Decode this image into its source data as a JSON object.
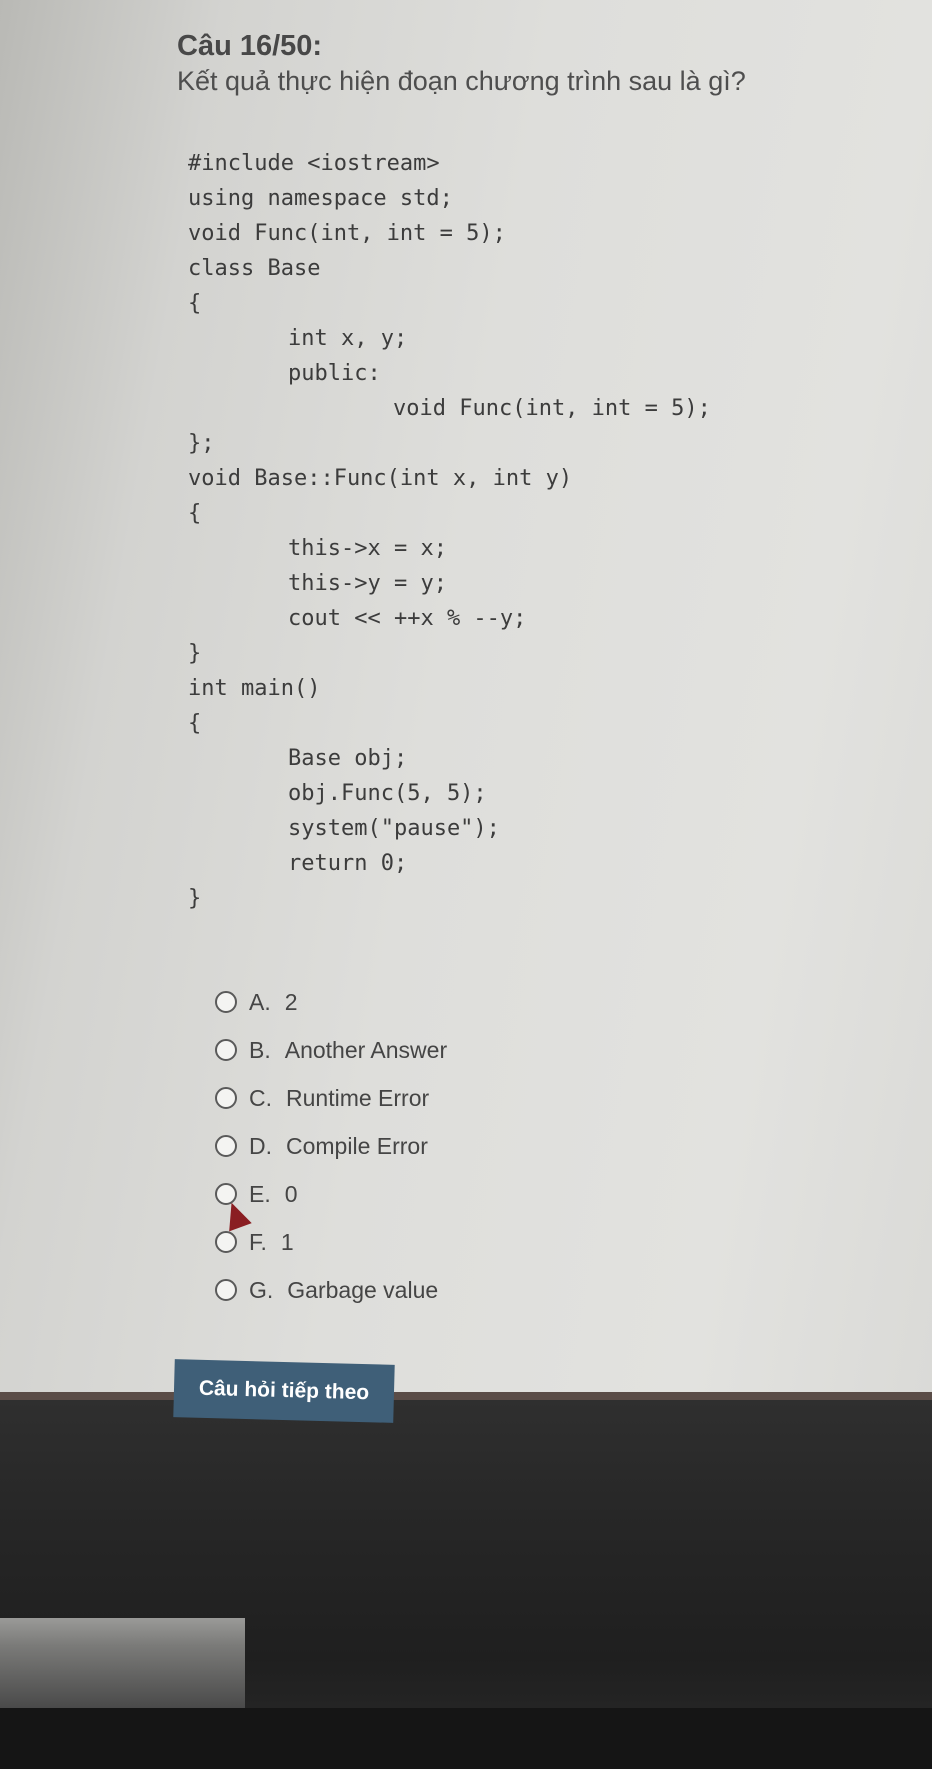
{
  "question": {
    "title": "Câu 16/50:",
    "prompt": "Kết quả thực hiện đoạn chương trình sau là gì?"
  },
  "code_lines": [
    "#include <iostream>",
    "using namespace std;",
    "void Func(int, int = 5);",
    "class Base",
    "{",
    "int x, y;",
    "public:",
    "void Func(int, int = 5);",
    "};",
    "void Base::Func(int x, int y)",
    "{",
    "this->x = x;",
    "this->y = y;",
    "cout << ++x % --y;",
    "}",
    "int main()",
    "{",
    "Base obj;",
    "obj.Func(5, 5);",
    "system(\"pause\");",
    "return 0;",
    "}"
  ],
  "options": [
    {
      "letter": "A.",
      "text": "2"
    },
    {
      "letter": "B.",
      "text": "Another Answer"
    },
    {
      "letter": "C.",
      "text": "Runtime Error"
    },
    {
      "letter": "D.",
      "text": "Compile Error"
    },
    {
      "letter": "E.",
      "text": "0"
    },
    {
      "letter": "F.",
      "text": "1"
    },
    {
      "letter": "G.",
      "text": "Garbage value"
    }
  ],
  "next_button": "Câu hỏi tiếp theo",
  "colors": {
    "button": "#3f5f78",
    "cursor": "#8a1e22"
  }
}
